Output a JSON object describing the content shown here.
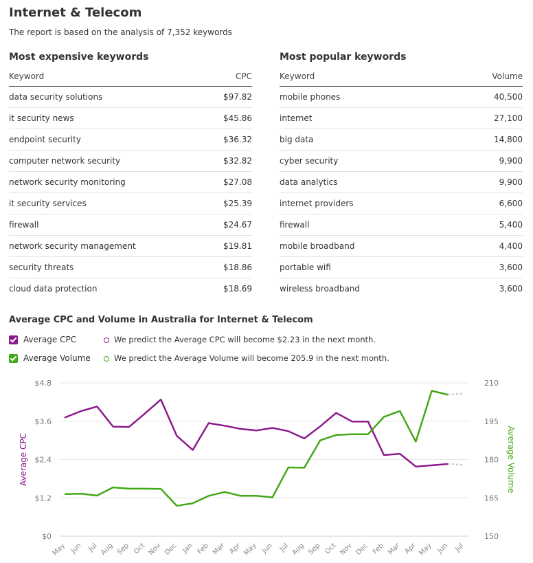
{
  "header": {
    "title": "Internet & Telecom",
    "subtitle": "The report is based on the analysis of 7,352 keywords"
  },
  "expensive": {
    "title": "Most expensive keywords",
    "col_keyword": "Keyword",
    "col_value": "CPC",
    "rows": [
      {
        "keyword": "data security solutions",
        "value": "$97.82"
      },
      {
        "keyword": "it security news",
        "value": "$45.86"
      },
      {
        "keyword": "endpoint security",
        "value": "$36.32"
      },
      {
        "keyword": "computer network security",
        "value": "$32.82"
      },
      {
        "keyword": "network security monitoring",
        "value": "$27.08"
      },
      {
        "keyword": "it security services",
        "value": "$25.39"
      },
      {
        "keyword": "firewall",
        "value": "$24.67"
      },
      {
        "keyword": "network security management",
        "value": "$19.81"
      },
      {
        "keyword": "security threats",
        "value": "$18.86"
      },
      {
        "keyword": "cloud data protection",
        "value": "$18.69"
      }
    ]
  },
  "popular": {
    "title": "Most popular keywords",
    "col_keyword": "Keyword",
    "col_value": "Volume",
    "rows": [
      {
        "keyword": "mobile phones",
        "value": "40,500"
      },
      {
        "keyword": "internet",
        "value": "27,100"
      },
      {
        "keyword": "big data",
        "value": "14,800"
      },
      {
        "keyword": "cyber security",
        "value": "9,900"
      },
      {
        "keyword": "data analytics",
        "value": "9,900"
      },
      {
        "keyword": "internet providers",
        "value": "6,600"
      },
      {
        "keyword": "firewall",
        "value": "5,400"
      },
      {
        "keyword": "mobile broadband",
        "value": "4,400"
      },
      {
        "keyword": "portable wifi",
        "value": "3,600"
      },
      {
        "keyword": "wireless broadband",
        "value": "3,600"
      }
    ]
  },
  "chart_section": {
    "title": "Average CPC and Volume in Australia for Internet & Telecom",
    "legend_cpc": "Average CPC",
    "legend_volume": "Average Volume",
    "predict_cpc": "We predict the Average CPC will become $2.23 in the next month.",
    "predict_volume": "We predict the Average Volume will become 205.9 in the next month.",
    "color_cpc": "#8a1a8c",
    "color_volume": "#43a816"
  },
  "chart_data": {
    "type": "line",
    "categories": [
      "May",
      "Jun",
      "Jul",
      "Aug",
      "Sep",
      "Oct",
      "Nov",
      "Dec",
      "Jan",
      "Feb",
      "Mar",
      "Apr",
      "May",
      "Jun",
      "Jul",
      "Aug",
      "Sep",
      "Oct",
      "Nov",
      "Dec",
      "Feb",
      "Mar",
      "Apr",
      "May",
      "Jun",
      "Jul"
    ],
    "series": [
      {
        "name": "Average CPC",
        "axis": "left",
        "color": "#8a1a8c",
        "values": [
          3.72,
          3.92,
          4.06,
          3.43,
          3.42,
          3.84,
          4.28,
          3.14,
          2.7,
          3.54,
          3.46,
          3.36,
          3.31,
          3.39,
          3.29,
          3.06,
          3.44,
          3.86,
          3.59,
          3.59,
          2.54,
          2.58,
          2.18,
          2.22,
          2.26,
          null
        ],
        "forecast": [
          2.26,
          2.23
        ]
      },
      {
        "name": "Average Volume",
        "axis": "right",
        "color": "#43a816",
        "values": [
          166.5,
          166.6,
          165.9,
          169.1,
          168.6,
          168.6,
          168.5,
          161.9,
          162.9,
          165.8,
          167.3,
          165.8,
          165.8,
          165.2,
          176.9,
          176.8,
          187.5,
          189.6,
          189.9,
          189.9,
          196.7,
          199,
          187,
          206.9,
          205.4,
          null
        ],
        "forecast": [
          205.4,
          205.9
        ]
      }
    ],
    "ylabel_left": "Average CPC",
    "ylabel_right": "Average Volume",
    "ylim_left": [
      0,
      4.8
    ],
    "ylim_right": [
      150,
      210
    ],
    "yticks_left": [
      "$0",
      "$1.2",
      "$2.4",
      "$3.6",
      "$4.8"
    ],
    "yticks_right": [
      "150",
      "165",
      "180",
      "195",
      "210"
    ],
    "grid": true
  }
}
